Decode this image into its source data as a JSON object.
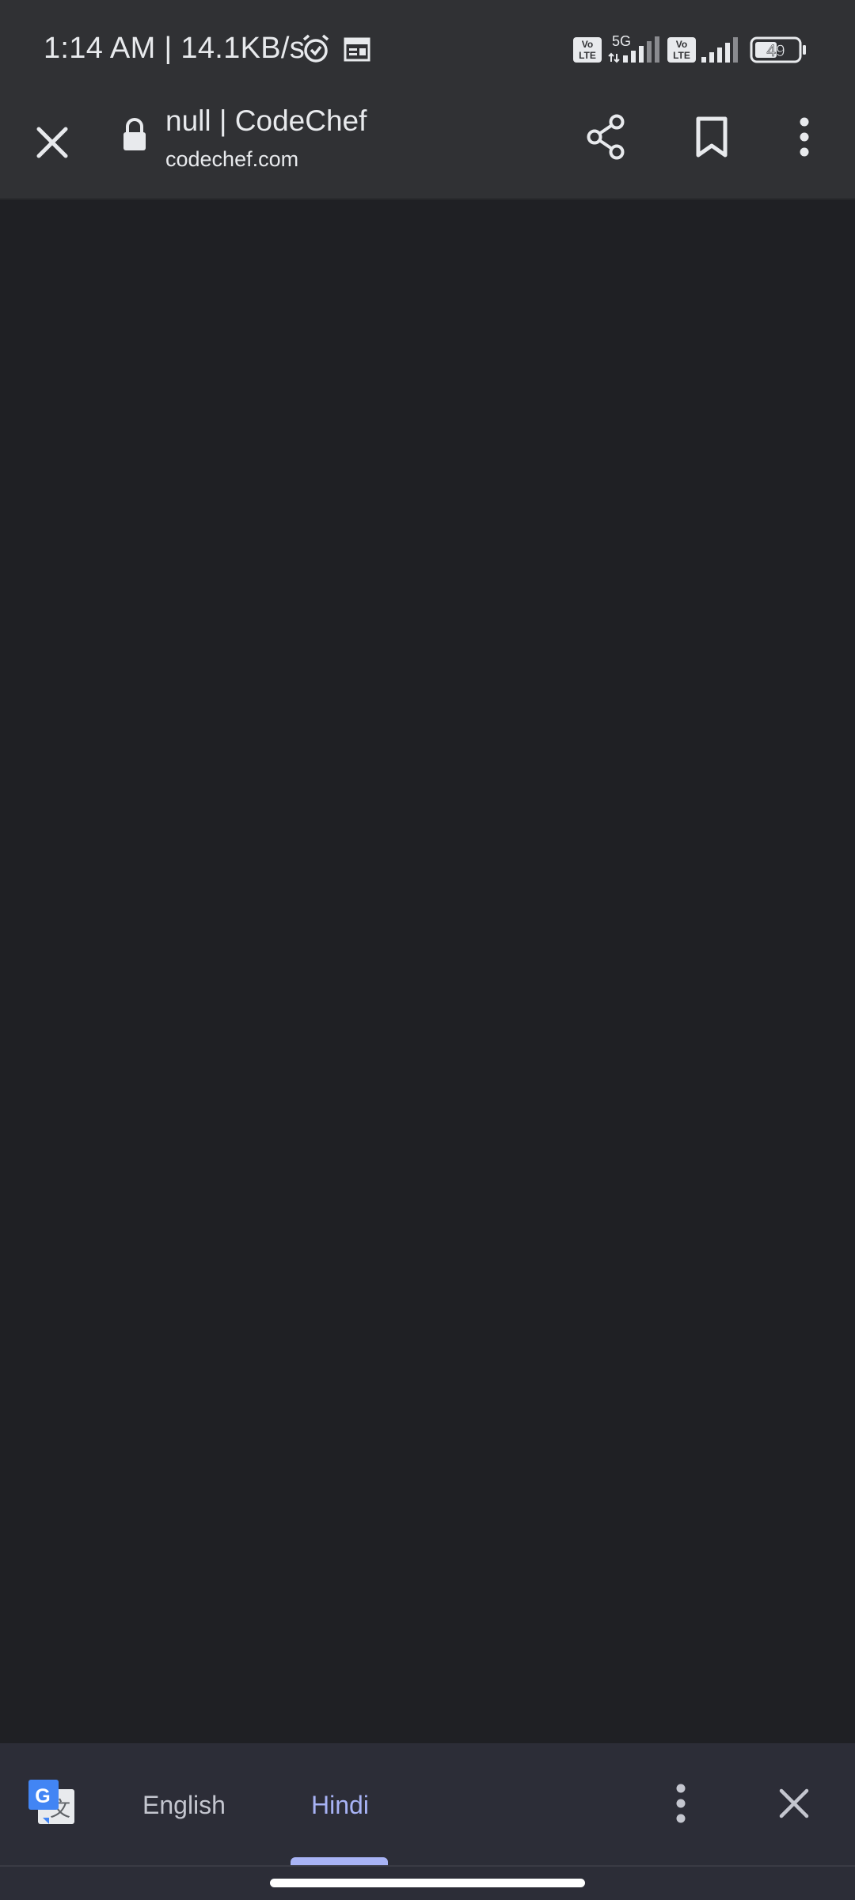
{
  "status_bar": {
    "time_speed": "1:14 AM | 14.1KB/s",
    "network_5g": "5G",
    "volte_label_1": "Vo",
    "volte_sub_1": "LTE",
    "volte_label_2": "Vo",
    "volte_sub_2": "LTE",
    "battery_level": "49"
  },
  "toolbar": {
    "page_title": "null | CodeChef",
    "page_url": "codechef.com"
  },
  "translate_bar": {
    "source_language": "English",
    "target_language": "Hindi",
    "active_color": "#a8b3f5",
    "inactive_color": "#c4c6cf"
  },
  "colors": {
    "background": "#1f2024",
    "toolbar": "#303134",
    "translate_bar": "#2c2d37"
  }
}
